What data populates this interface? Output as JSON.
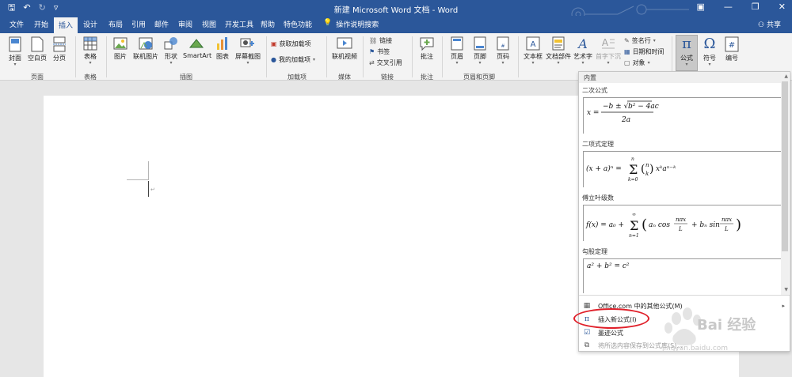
{
  "window": {
    "title": "新建 Microsoft Word 文档 - Word",
    "share_label": "共享"
  },
  "tabs": [
    {
      "label": "文件"
    },
    {
      "label": "开始"
    },
    {
      "label": "插入"
    },
    {
      "label": "设计"
    },
    {
      "label": "布局"
    },
    {
      "label": "引用"
    },
    {
      "label": "邮件"
    },
    {
      "label": "审阅"
    },
    {
      "label": "视图"
    },
    {
      "label": "开发工具"
    },
    {
      "label": "帮助"
    },
    {
      "label": "特色功能"
    }
  ],
  "active_tab": "插入",
  "tell_me": "操作说明搜索",
  "ribbon": {
    "pages": {
      "label": "页面",
      "cover": "封面",
      "blank": "空白页",
      "break": "分页"
    },
    "tables": {
      "label": "表格",
      "table": "表格"
    },
    "illustrations": {
      "label": "插图",
      "picture": "图片",
      "online_picture": "联机图片",
      "shapes": "形状",
      "smartart": "SmartArt",
      "chart": "图表",
      "screenshot": "屏幕截图"
    },
    "addins": {
      "label": "加载项",
      "get": "获取加载项",
      "my": "我的加载项"
    },
    "media": {
      "label": "媒体",
      "online_video": "联机视频"
    },
    "links": {
      "label": "链接",
      "link": "链接",
      "bookmark": "书签",
      "cross_ref": "交叉引用"
    },
    "comments": {
      "label": "批注",
      "comment": "批注"
    },
    "header_footer": {
      "label": "页眉和页脚",
      "header": "页眉",
      "footer": "页脚",
      "page_number": "页码"
    },
    "text": {
      "textbox": "文本框",
      "quick_parts": "文档部件",
      "wordart": "艺术字",
      "dropcap": "首字下沉",
      "signature": "签名行",
      "datetime": "日期和时间",
      "object": "对象"
    },
    "symbols": {
      "equation": "公式",
      "symbol": "符号",
      "number": "编号"
    }
  },
  "equation_menu": {
    "header": "内置",
    "items": [
      {
        "title": "二次公式",
        "formula": "x = (−b ± √(b² − 4ac)) / 2a"
      },
      {
        "title": "二项式定理",
        "formula": "(x + a)ⁿ = Σₖ₌₀ⁿ (n k) xᵏ aⁿ⁻ᵏ"
      },
      {
        "title": "傅立叶级数",
        "formula": "f(x) = a₀ + Σₙ₌₁^∞ (aₙ cos nπx/L + bₙ sin nπx/L)"
      },
      {
        "title": "勾股定理",
        "formula": "a² + b² = c²"
      }
    ],
    "more_online": "Office.com 中的其他公式(M)",
    "insert_new": "插入新公式(I)",
    "ink": "墨迹公式",
    "save_selection": "将所选内容保存到公式库(S)..."
  },
  "watermark": {
    "text": "Bai 经验",
    "sub": "jingyan.baidu.com"
  },
  "colors": {
    "word_blue": "#2b579a",
    "highlight_red": "#e0202a"
  }
}
